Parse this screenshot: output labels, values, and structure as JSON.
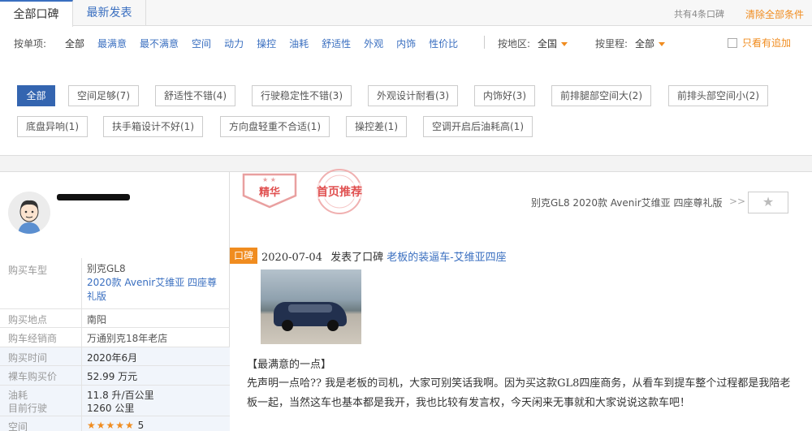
{
  "tabs": {
    "active": "全部口碑",
    "inactive": "最新发表"
  },
  "summary": {
    "total": "共有4条口碑",
    "clear": "清除全部条件"
  },
  "filters": {
    "item_label": "按单项:",
    "items": [
      "全部",
      "最满意",
      "最不满意",
      "空间",
      "动力",
      "操控",
      "油耗",
      "舒适性",
      "外观",
      "内饰",
      "性价比"
    ],
    "region_label": "按地区:",
    "region_value": "全国",
    "mileage_label": "按里程:",
    "mileage_value": "全部",
    "followup_label": "只看有追加"
  },
  "tags": [
    "全部",
    "空间足够(7)",
    "舒适性不错(4)",
    "行驶稳定性不错(3)",
    "外观设计耐看(3)",
    "内饰好(3)",
    "前排腿部空间大(2)",
    "前排头部空间小(2)",
    "底盘异响(1)",
    "扶手箱设计不好(1)",
    "方向盘轻重不合适(1)",
    "操控差(1)",
    "空调开启后油耗高(1)"
  ],
  "badges": {
    "jinghua": "精华",
    "tuijian": "首页推荐"
  },
  "car_link": "别克GL8 2020款 Avenir艾维亚 四座尊礼版",
  "chevrons": ">>",
  "star_icon": "★",
  "info": {
    "model_label": "购买车型",
    "model_series": "别克GL8",
    "model_version": "2020款 Avenir艾维亚 四座尊礼版",
    "place_label": "购买地点",
    "place_value": "南阳",
    "dealer_label": "购车经销商",
    "dealer_value": "万通别克18年老店",
    "time_label": "购买时间",
    "time_value": "2020年6月",
    "price_label": "裸车购买价",
    "price_value": "52.99 万元",
    "fuel_label": "油耗",
    "fuel_value": "11.8 升/百公里",
    "mileage_label": "目前行驶",
    "mileage_value": "1260 公里",
    "space_label": "空间",
    "space_stars": "★★★★★",
    "space_score": "5"
  },
  "post": {
    "tag": "口碑",
    "date": "2020-07-04",
    "action": "发表了口碑",
    "title": "老板的装逼车-艾维亚四座",
    "section_title": "【最满意的一点】",
    "body": "先声明一点哈?? 我是老板的司机，大家可别笑话我啊。因为买这款GL8四座商务，从看车到提车整个过程都是我陪老板一起，当然这车也基本都是我开，我也比较有发言权，今天闲来无事就和大家说说这款车吧！"
  },
  "colors": {
    "accent": "#3a6fc0",
    "orange": "#f08c1f",
    "badge_red": "#e03a3a"
  }
}
